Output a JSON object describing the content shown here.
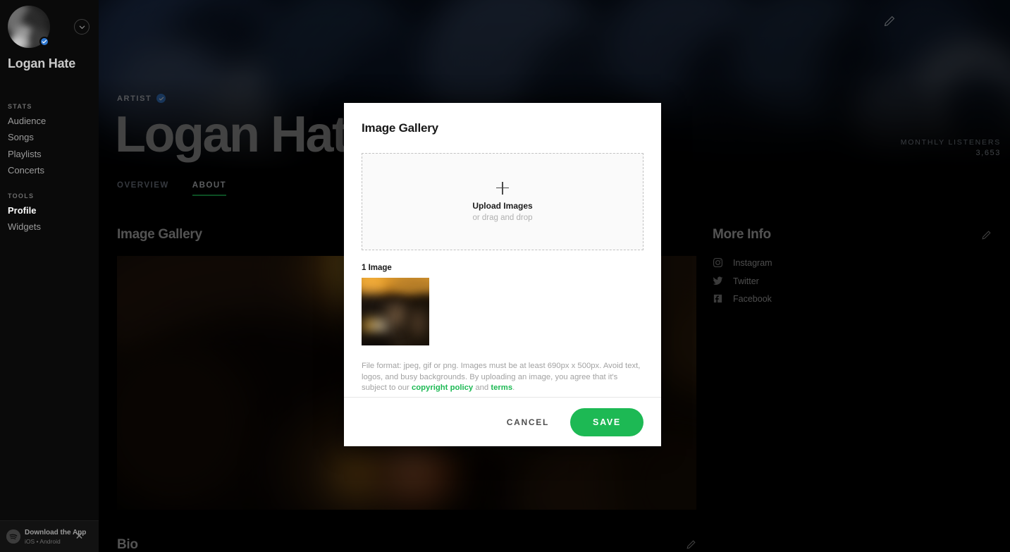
{
  "sidebar": {
    "artist_name": "Logan Hate",
    "avatar_icon": "artist-avatar",
    "verified_icon": "verified-check-icon",
    "collapse_icon": "chevron-down-icon",
    "sections": [
      {
        "heading": "STATS",
        "items": [
          {
            "label": "Audience",
            "active": false
          },
          {
            "label": "Songs",
            "active": false
          },
          {
            "label": "Playlists",
            "active": false
          },
          {
            "label": "Concerts",
            "active": false
          }
        ]
      },
      {
        "heading": "TOOLS",
        "items": [
          {
            "label": "Profile",
            "active": true
          },
          {
            "label": "Widgets",
            "active": false
          }
        ]
      }
    ],
    "download": {
      "logo_icon": "spotify-logo-icon",
      "title": "Download the App",
      "subtitle": "iOS  •  Android",
      "close_icon": "close-icon"
    }
  },
  "hero": {
    "artist_label": "ARTIST",
    "verified_icon": "verified-check-icon",
    "title": "Logan Hate",
    "edit_icon": "pencil-edit-icon",
    "monthly_listeners_label": "MONTHLY LISTENERS",
    "monthly_listeners_value": "3,653"
  },
  "tabs": [
    {
      "label": "OVERVIEW",
      "active": false
    },
    {
      "label": "ABOUT",
      "active": true
    }
  ],
  "main": {
    "gallery_heading": "Image Gallery",
    "gallery_photo_alt": "concert-crowd-photo",
    "bio_heading": "Bio",
    "bio_edit_icon": "pencil-edit-icon"
  },
  "more_info": {
    "heading": "More Info",
    "edit_icon": "pencil-edit-icon",
    "links": [
      {
        "label": "Instagram",
        "icon": "instagram-icon"
      },
      {
        "label": "Twitter",
        "icon": "twitter-icon"
      },
      {
        "label": "Facebook",
        "icon": "facebook-icon"
      }
    ]
  },
  "modal": {
    "title": "Image Gallery",
    "dropzone": {
      "plus_icon": "plus-icon",
      "title": "Upload Images",
      "subtitle": "or drag and drop"
    },
    "image_count": "1 Image",
    "thumbnail_alt": "uploaded-concert-thumbnail",
    "file_note": {
      "part1": "File format: jpeg, gif or png. Images must be at least 690px x 500px. Avoid text, logos, and busy backgrounds. By uploading an image, you agree that it's subject to our ",
      "link1": "copyright policy",
      "mid": " and ",
      "link2": "terms",
      "end": "."
    },
    "cancel_label": "CANCEL",
    "save_label": "SAVE"
  },
  "colors": {
    "accent_green": "#1db954",
    "verified_blue": "#3a7fd5",
    "sidebar_bg": "#0a0a0a",
    "modal_bg": "#ffffff"
  }
}
